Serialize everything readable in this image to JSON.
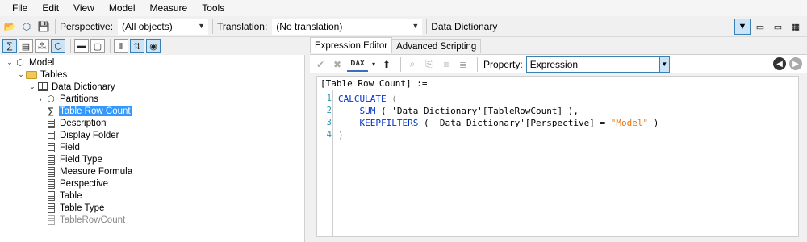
{
  "menu": [
    "File",
    "Edit",
    "View",
    "Model",
    "Measure",
    "Tools"
  ],
  "toolbar": {
    "perspective_label": "Perspective:",
    "perspective_value": "(All objects)",
    "translation_label": "Translation:",
    "translation_value": "(No translation)",
    "table_value": "Data Dictionary"
  },
  "tree": {
    "model": "Model",
    "tables": "Tables",
    "table": "Data Dictionary",
    "items": [
      "Partitions",
      "Table Row Count",
      "Description",
      "Display Folder",
      "Field",
      "Field Type",
      "Measure Formula",
      "Perspective",
      "Table",
      "Table Type",
      "TableRowCount"
    ]
  },
  "tabs": [
    "Expression Editor",
    "Advanced Scripting"
  ],
  "editor": {
    "dax_label": "DAX",
    "property_label": "Property:",
    "property_value": "Expression",
    "header": "[Table Row Count] :=",
    "line_numbers": [
      "1",
      "2",
      "3",
      "4"
    ],
    "code": {
      "calculate": "CALCULATE",
      "open_paren": " (",
      "sum": "SUM",
      "sum_arg": " ( 'Data Dictionary'[TableRowCount] ),",
      "keepfilters": "KEEPFILTERS",
      "kf_arg": " ( 'Data Dictionary'[Perspective] = ",
      "kf_literal": "\"Model\"",
      "kf_close": " )",
      "close_paren": ")"
    }
  }
}
